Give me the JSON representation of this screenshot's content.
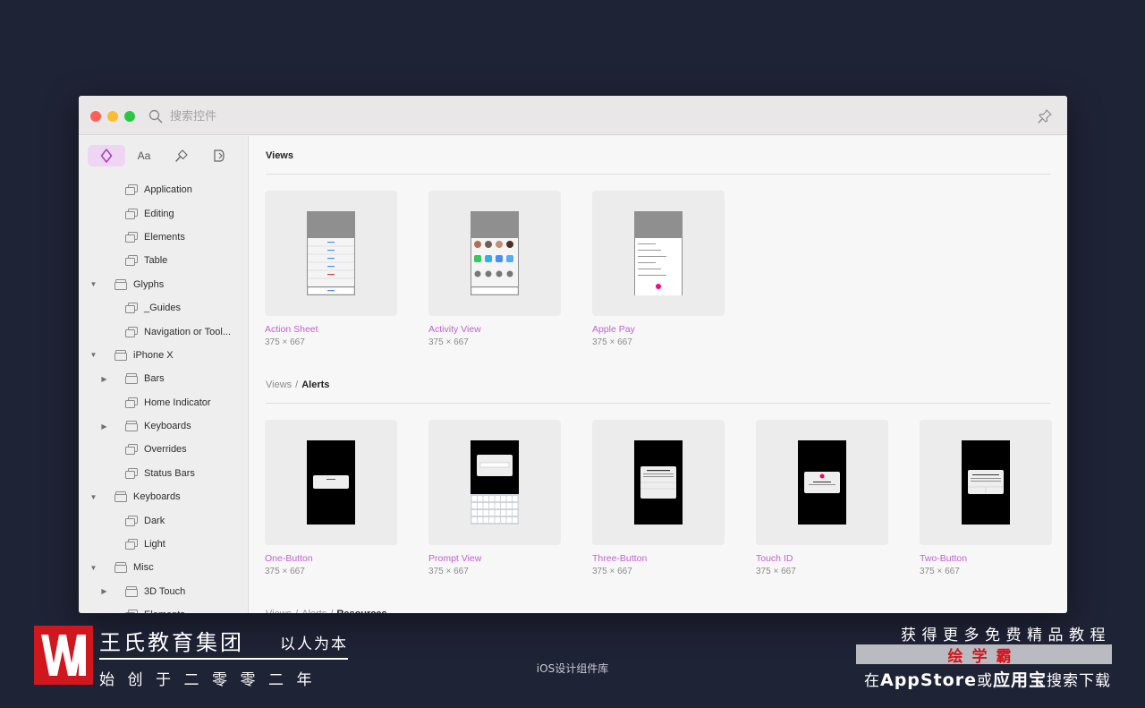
{
  "search": {
    "placeholder": "搜索控件"
  },
  "toolbar": {
    "tabs": [
      {
        "icon": "symbol-icon",
        "label": ""
      },
      {
        "icon": "text-style-icon",
        "label": "Aa"
      },
      {
        "icon": "brush-icon",
        "label": ""
      },
      {
        "icon": "layer-style-icon",
        "label": ""
      }
    ]
  },
  "sidebar": {
    "items": [
      {
        "label": "Application",
        "level": 2,
        "expand": "none"
      },
      {
        "label": "Editing",
        "level": 2,
        "expand": "none"
      },
      {
        "label": "Elements",
        "level": 2,
        "expand": "none"
      },
      {
        "label": "Table",
        "level": 2,
        "expand": "none"
      },
      {
        "label": "Glyphs",
        "level": 1,
        "expand": "expanded"
      },
      {
        "label": "_Guides",
        "level": 2,
        "expand": "none"
      },
      {
        "label": "Navigation or Tool...",
        "level": 2,
        "expand": "none"
      },
      {
        "label": "iPhone X",
        "level": 1,
        "expand": "expanded"
      },
      {
        "label": "Bars",
        "level": 2,
        "expand": "collapsed"
      },
      {
        "label": "Home Indicator",
        "level": 2,
        "expand": "none"
      },
      {
        "label": "Keyboards",
        "level": 2,
        "expand": "collapsed"
      },
      {
        "label": "Overrides",
        "level": 2,
        "expand": "none"
      },
      {
        "label": "Status Bars",
        "level": 2,
        "expand": "none"
      },
      {
        "label": "Keyboards",
        "level": 1,
        "expand": "expanded"
      },
      {
        "label": "Dark",
        "level": 2,
        "expand": "none"
      },
      {
        "label": "Light",
        "level": 2,
        "expand": "none"
      },
      {
        "label": "Misc",
        "level": 1,
        "expand": "expanded"
      },
      {
        "label": "3D Touch",
        "level": 2,
        "expand": "collapsed"
      },
      {
        "label": "Elements",
        "level": 2,
        "expand": "none"
      }
    ]
  },
  "content": {
    "sections": [
      {
        "path": [],
        "title": "Views",
        "items": [
          {
            "name": "Action Sheet",
            "size": "375 × 667",
            "preview": "action-sheet"
          },
          {
            "name": "Activity View",
            "size": "375 × 667",
            "preview": "activity-view"
          },
          {
            "name": "Apple Pay",
            "size": "375 × 667",
            "preview": "apple-pay"
          }
        ]
      },
      {
        "path": [
          "Views"
        ],
        "title": "Alerts",
        "items": [
          {
            "name": "One-Button",
            "size": "375 × 667",
            "preview": "alert-one"
          },
          {
            "name": "Prompt View",
            "size": "375 × 667",
            "preview": "alert-prompt"
          },
          {
            "name": "Three-Button",
            "size": "375 × 667",
            "preview": "alert-three"
          },
          {
            "name": "Touch ID",
            "size": "375 × 667",
            "preview": "alert-touchid"
          },
          {
            "name": "Two-Button",
            "size": "375 × 667",
            "preview": "alert-two"
          }
        ]
      },
      {
        "path": [
          "Views",
          "Alerts"
        ],
        "title": "Resources",
        "items": []
      }
    ]
  },
  "footer": {
    "brand_name": "王氏教育集团",
    "slogan": "以人为本",
    "founded": "始创于二零零二年",
    "caption": "iOS设计组件库",
    "promo_line1": "获得更多免费精品教程",
    "promo_app": "绘学霸",
    "promo_line2_pre": "在",
    "promo_line2_store": "AppStore",
    "promo_line2_mid": "或",
    "promo_line2_store2": "应用宝",
    "promo_line2_post": "搜索下载"
  },
  "colors": {
    "accent": "#c25fd6",
    "background": "#1f2336",
    "brand_red": "#d1171e",
    "traffic_red": "#fe5f57",
    "traffic_yellow": "#febc2e",
    "traffic_green": "#28c840"
  }
}
